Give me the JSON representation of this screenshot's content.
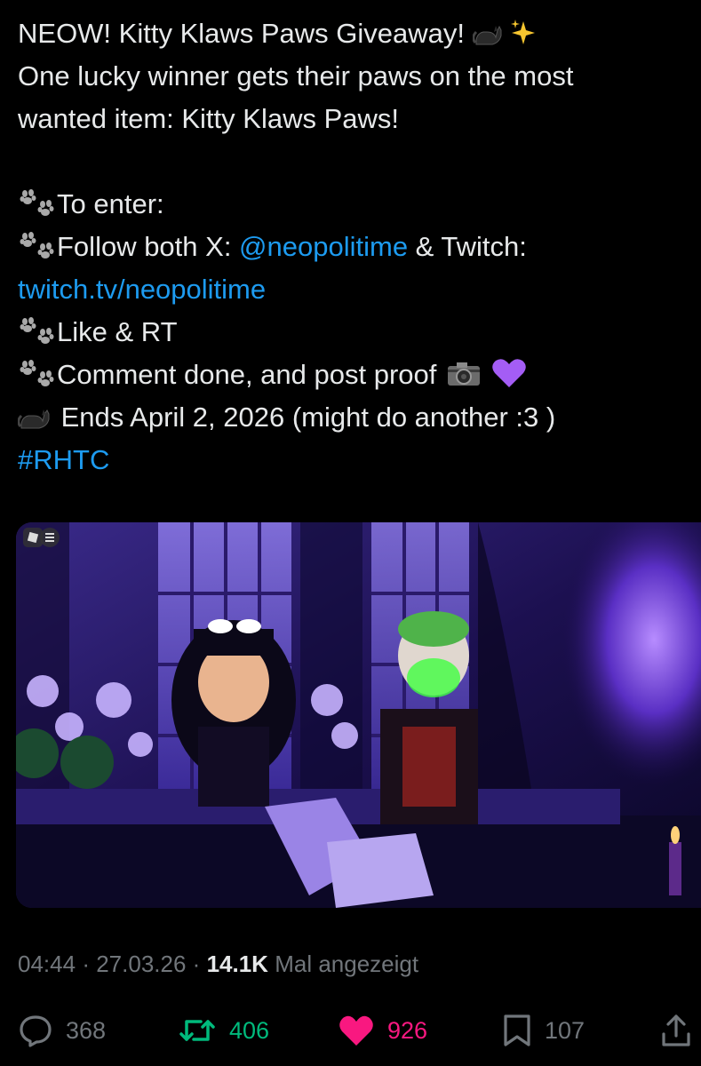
{
  "tweet": {
    "line1": "NEOW! Kitty Klaws Paws Giveaway!",
    "line2": "One lucky winner gets their paws on the most",
    "line3": "wanted item: Kitty Klaws Paws!",
    "enter_label": "To enter:",
    "follow_prefix": "Follow both X: ",
    "follow_handle": "@neopolitime",
    "follow_mid": " & Twitch:",
    "twitch_link": "twitch.tv/neopolitime",
    "like_rt": "Like & RT",
    "comment_text": "Comment done, and post proof ",
    "ends_text": " Ends April 2, 2026 (might do another :3 )",
    "hashtag": "#RHTC",
    "emojis": [
      "black-cat",
      "sparkles",
      "paw-prints",
      "camera-with-flash",
      "purple-heart"
    ]
  },
  "media": {
    "description_icons": [
      "roblox-logo-icon",
      "menu-icon"
    ]
  },
  "meta": {
    "time": "04:44",
    "date": "27.03.26",
    "views_count": "14.1K",
    "views_label": "Mal angezeigt",
    "separator": "·"
  },
  "actions": {
    "replies": "368",
    "retweets": "406",
    "likes": "926",
    "bookmarks": "107"
  },
  "colors": {
    "background": "#000000",
    "text": "#e7e9ea",
    "link": "#1d9bf0",
    "muted": "#71767b",
    "retweet": "#00ba7c",
    "like": "#f91880"
  }
}
